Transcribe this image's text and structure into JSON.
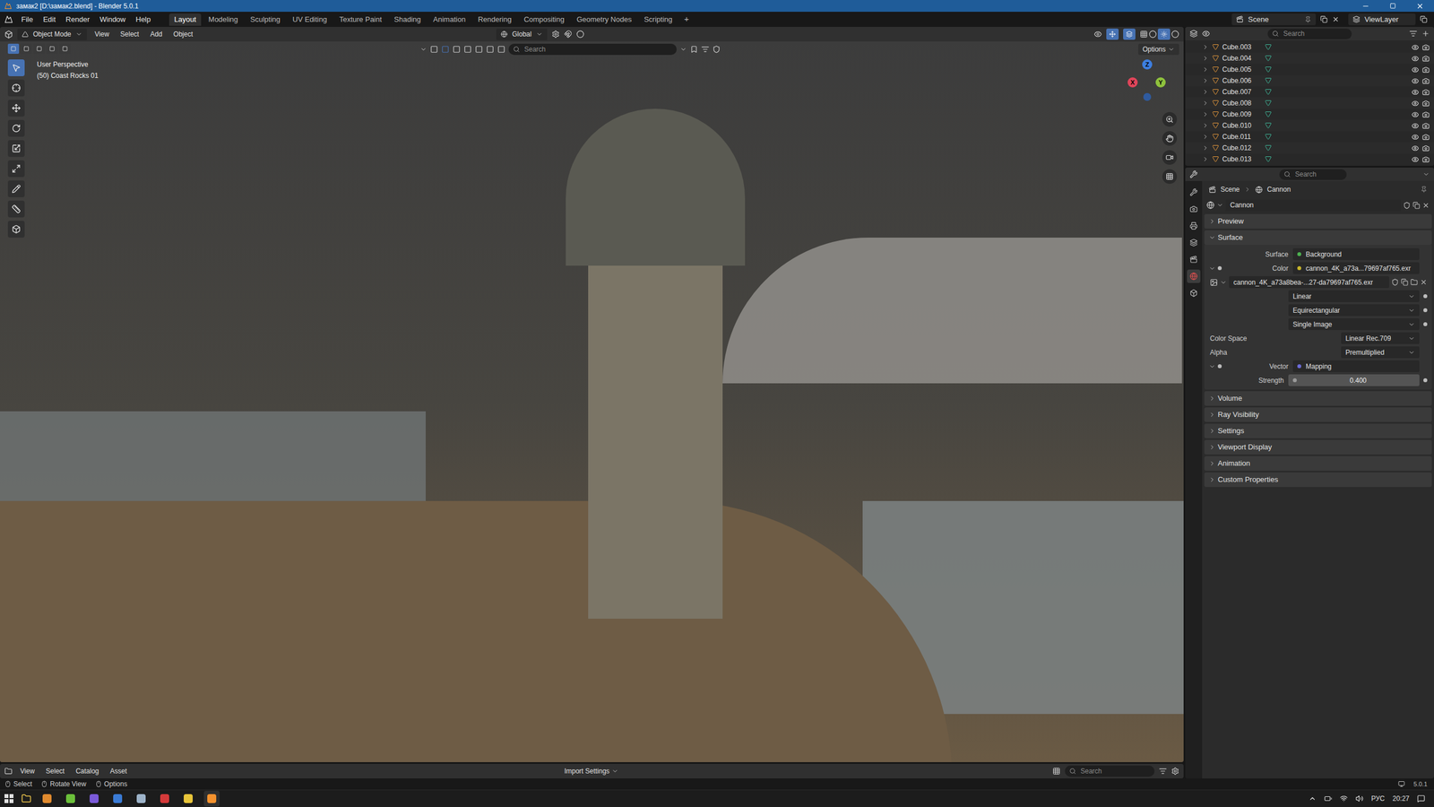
{
  "window": {
    "title": "замак2 [D:\\замак2.blend] - Blender 5.0.1"
  },
  "menu": [
    "File",
    "Edit",
    "Render",
    "Window",
    "Help"
  ],
  "workspaces": [
    {
      "label": "Layout",
      "selected": true
    },
    {
      "label": "Modeling",
      "selected": false
    },
    {
      "label": "Sculpting",
      "selected": false
    },
    {
      "label": "UV Editing",
      "selected": false
    },
    {
      "label": "Texture Paint",
      "selected": false
    },
    {
      "label": "Shading",
      "selected": false
    },
    {
      "label": "Animation",
      "selected": false
    },
    {
      "label": "Rendering",
      "selected": false
    },
    {
      "label": "Compositing",
      "selected": false
    },
    {
      "label": "Geometry Nodes",
      "selected": false
    },
    {
      "label": "Scripting",
      "selected": false
    }
  ],
  "add_workspace": "+",
  "scene": "Scene",
  "view_layer": "ViewLayer",
  "viewport": {
    "mode": "Object Mode",
    "menus": [
      "View",
      "Select",
      "Add",
      "Object"
    ],
    "orientation": "Global",
    "search_placeholder": "Search",
    "options": "Options",
    "overlay": [
      "User Perspective",
      "(50) Coast Rocks 01"
    ],
    "gizmo_axes": [
      {
        "label": "Z",
        "color": "#3d7fe0"
      },
      {
        "label": "X",
        "color": "#e0455a"
      },
      {
        "label": "Y",
        "color": "#8fc23d"
      }
    ]
  },
  "outliner": {
    "search_placeholder": "Search",
    "items": [
      {
        "name": "Cube.003",
        "visible": true
      },
      {
        "name": "Cube.004",
        "visible": true
      },
      {
        "name": "Cube.005",
        "visible": true
      },
      {
        "name": "Cube.006",
        "visible": true
      },
      {
        "name": "Cube.007",
        "visible": true
      },
      {
        "name": "Cube.008",
        "visible": true
      },
      {
        "name": "Cube.009",
        "visible": true
      },
      {
        "name": "Cube.010",
        "visible": true
      },
      {
        "name": "Cube.011",
        "visible": true
      },
      {
        "name": "Cube.012",
        "visible": true
      },
      {
        "name": "Cube.013",
        "visible": true
      }
    ]
  },
  "properties": {
    "search_placeholder": "Search",
    "breadcrumb": [
      "Scene",
      "Cannon"
    ],
    "world_name": "Cannon",
    "panels_before": [
      {
        "label": "Preview",
        "expanded": false
      }
    ],
    "surface_panel": {
      "label": "Surface",
      "expanded": true
    },
    "surface_rows": [
      {
        "kind": "socket",
        "label": "Surface",
        "value": "Background",
        "color": "#4caf50",
        "expandable": false
      },
      {
        "kind": "socket",
        "label": "Color",
        "value": "cannon_4K_a73a...79697af765.exr",
        "color": "#c7b52b",
        "expandable": true
      },
      {
        "kind": "image",
        "value": "cannon_4K_a73a8bea-...27-da79697af765.exr"
      },
      {
        "kind": "dropdown",
        "value": "Linear"
      },
      {
        "kind": "dropdown",
        "value": "Equirectangular"
      },
      {
        "kind": "dropdown",
        "value": "Single Image"
      },
      {
        "kind": "split",
        "label": "Color Space",
        "value": "Linear Rec.709"
      },
      {
        "kind": "split",
        "label": "Alpha",
        "value": "Premultiplied"
      },
      {
        "kind": "socket",
        "label": "Vector",
        "value": "Mapping",
        "color": "#6b6bd6",
        "expandable": true
      },
      {
        "kind": "number",
        "label": "Strength",
        "value": "0.400",
        "color": "#9a9a9a"
      }
    ],
    "panels_after": [
      {
        "label": "Volume",
        "expanded": false
      },
      {
        "label": "Ray Visibility",
        "expanded": false
      },
      {
        "label": "Settings",
        "expanded": false
      },
      {
        "label": "Viewport Display",
        "expanded": false
      },
      {
        "label": "Animation",
        "expanded": false
      },
      {
        "label": "Custom Properties",
        "expanded": false
      }
    ]
  },
  "asset_browser": {
    "menus": [
      "View",
      "Select",
      "Catalog",
      "Asset"
    ],
    "import_settings": "Import Settings",
    "search_placeholder": "Search"
  },
  "status_bar": {
    "items": [
      "Select",
      "Rotate View",
      "Options"
    ],
    "version": "5.0.1"
  },
  "taskbar": {
    "language": "РУС",
    "time": "20:27"
  }
}
